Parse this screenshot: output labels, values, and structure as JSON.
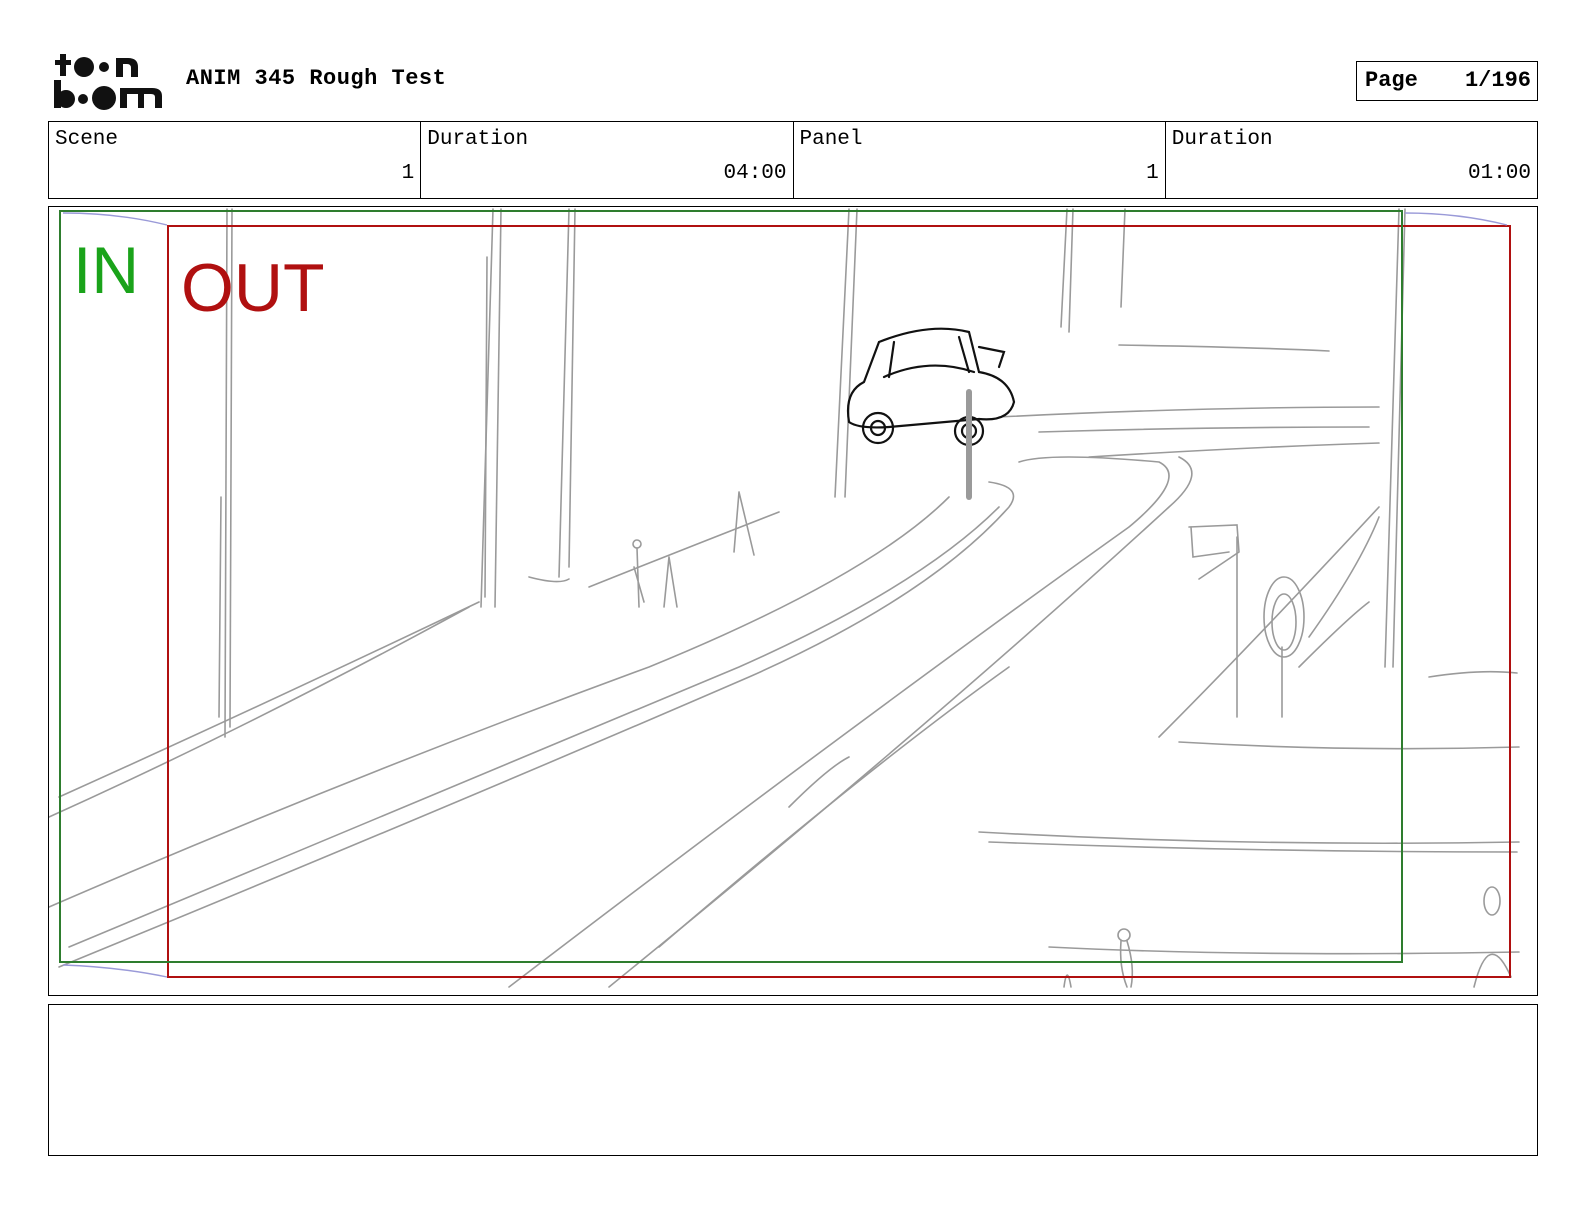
{
  "header": {
    "logo_text": "toon boom",
    "title": "ANIM 345 Rough Test",
    "page_label": "Page",
    "page_value": "1/196"
  },
  "info": {
    "scene_label": "Scene",
    "scene_value": "1",
    "scene_duration_label": "Duration",
    "scene_duration_value": "04:00",
    "panel_label": "Panel",
    "panel_value": "1",
    "panel_duration_label": "Duration",
    "panel_duration_value": "01:00"
  },
  "panel": {
    "in_label": "IN",
    "out_label": "OUT",
    "in_color": "#1aa31a",
    "out_color": "#b01010",
    "in_frame_color": "#2e7d2e",
    "out_frame_color": "#b01010",
    "sketch_color": "#9a9a9a",
    "ink_color": "#111111"
  },
  "notes": {
    "text": ""
  }
}
